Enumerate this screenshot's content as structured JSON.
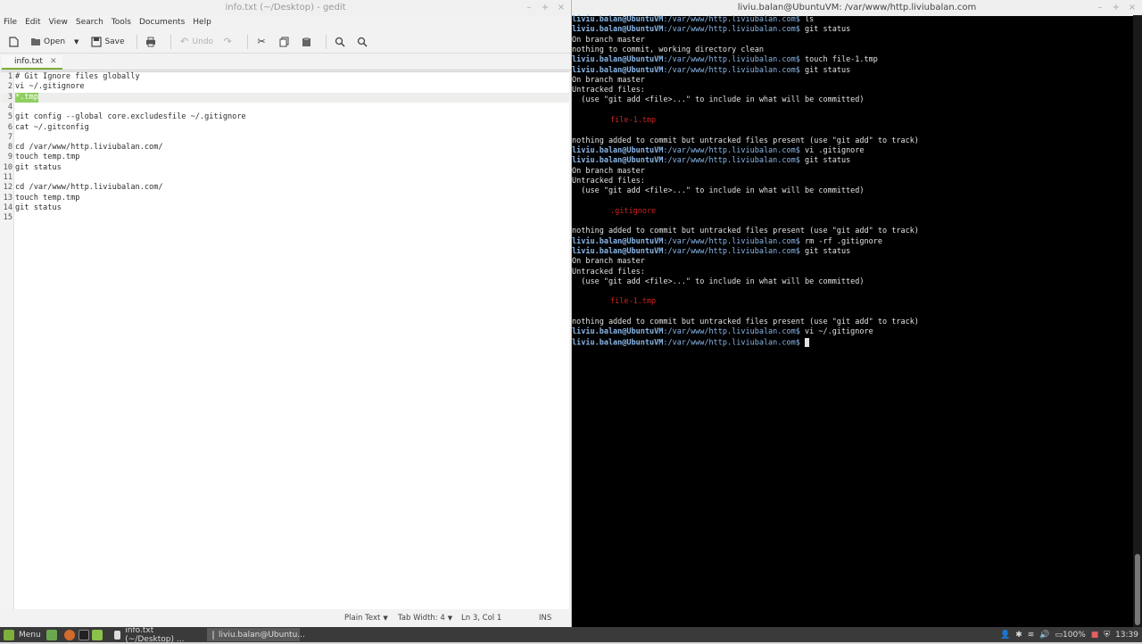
{
  "gedit": {
    "title": "info.txt (~/Desktop) - gedit",
    "menu": [
      "File",
      "Edit",
      "View",
      "Search",
      "Tools",
      "Documents",
      "Help"
    ],
    "toolbar": {
      "open": "Open",
      "save": "Save",
      "undo": "Undo"
    },
    "tab": {
      "name": "info.txt"
    },
    "lines": [
      {
        "n": "1",
        "text": "# Git Ignore files globally"
      },
      {
        "n": "2",
        "text": "vi ~/.gitignore"
      },
      {
        "n": "3",
        "text": "*.tmp"
      },
      {
        "n": "4",
        "text": ""
      },
      {
        "n": "5",
        "text": "git config --global core.excludesfile ~/.gitignore"
      },
      {
        "n": "6",
        "text": "cat ~/.gitconfig"
      },
      {
        "n": "7",
        "text": ""
      },
      {
        "n": "8",
        "text": "cd /var/www/http.liviubalan.com/"
      },
      {
        "n": "9",
        "text": "touch temp.tmp"
      },
      {
        "n": "10",
        "text": "git status"
      },
      {
        "n": "11",
        "text": ""
      },
      {
        "n": "12",
        "text": "cd /var/www/http.liviubalan.com/"
      },
      {
        "n": "13",
        "text": "touch temp.tmp"
      },
      {
        "n": "14",
        "text": "git status"
      },
      {
        "n": "15",
        "text": ""
      }
    ],
    "status": {
      "lang": "Plain Text",
      "tab_width": "Tab Width: 4",
      "position": "Ln 3, Col 1",
      "mode": "INS"
    }
  },
  "terminal": {
    "title": "liviu.balan@UbuntuVM: /var/www/http.liviubalan.com",
    "prompt_user": "liviu.balan@UbuntuVM",
    "prompt_path": ":/var/www/http.liviubalan.com$",
    "lines": [
      {
        "type": "cmd",
        "text": " ls"
      },
      {
        "type": "cmd",
        "text": " git status"
      },
      {
        "type": "out",
        "text": "On branch master"
      },
      {
        "type": "out",
        "text": "nothing to commit, working directory clean"
      },
      {
        "type": "cmd",
        "text": " touch file-1.tmp"
      },
      {
        "type": "cmd",
        "text": " git status"
      },
      {
        "type": "out",
        "text": "On branch master"
      },
      {
        "type": "out",
        "text": "Untracked files:"
      },
      {
        "type": "out",
        "text": "  (use \"git add <file>...\" to include in what will be committed)"
      },
      {
        "type": "out",
        "text": ""
      },
      {
        "type": "red",
        "text": "\tfile-1.tmp"
      },
      {
        "type": "out",
        "text": ""
      },
      {
        "type": "out",
        "text": "nothing added to commit but untracked files present (use \"git add\" to track)"
      },
      {
        "type": "cmd",
        "text": " vi .gitignore"
      },
      {
        "type": "cmd",
        "text": " git status"
      },
      {
        "type": "out",
        "text": "On branch master"
      },
      {
        "type": "out",
        "text": "Untracked files:"
      },
      {
        "type": "out",
        "text": "  (use \"git add <file>...\" to include in what will be committed)"
      },
      {
        "type": "out",
        "text": ""
      },
      {
        "type": "red",
        "text": "\t.gitignore"
      },
      {
        "type": "out",
        "text": ""
      },
      {
        "type": "out",
        "text": "nothing added to commit but untracked files present (use \"git add\" to track)"
      },
      {
        "type": "cmd",
        "text": " rm -rf .gitignore"
      },
      {
        "type": "cmd",
        "text": " git status"
      },
      {
        "type": "out",
        "text": "On branch master"
      },
      {
        "type": "out",
        "text": "Untracked files:"
      },
      {
        "type": "out",
        "text": "  (use \"git add <file>...\" to include in what will be committed)"
      },
      {
        "type": "out",
        "text": ""
      },
      {
        "type": "red",
        "text": "\tfile-1.tmp"
      },
      {
        "type": "out",
        "text": ""
      },
      {
        "type": "out",
        "text": "nothing added to commit but untracked files present (use \"git add\" to track)"
      },
      {
        "type": "cmd",
        "text": " vi ~/.gitignore"
      },
      {
        "type": "cursor",
        "text": " "
      }
    ]
  },
  "panel": {
    "menu": "Menu",
    "tasks": [
      "info.txt (~/Desktop) ...",
      "liviu.balan@Ubuntu..."
    ],
    "battery": "100%",
    "clock": "13:39"
  },
  "colors": {
    "accent": "#7db03a",
    "highlight": "#8fcf5f",
    "prompt": "#8ab6e8",
    "untracked": "#cc2222"
  }
}
